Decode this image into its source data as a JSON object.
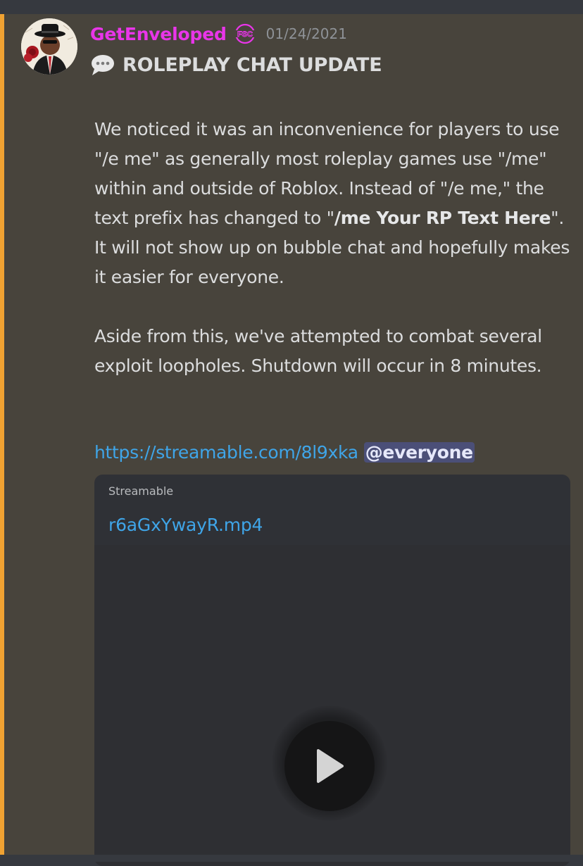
{
  "message": {
    "author": {
      "name": "GetEnveloped",
      "name_color": "#e935e9",
      "avatar_icon": "fedora-gentleman-avatar",
      "badge_icon": "fsc-badge-icon",
      "badge_text": "FSC"
    },
    "timestamp": "01/24/2021",
    "accent_color": "#f0a232",
    "title_icon": "speech-balloon-icon",
    "title": "ROLEPLAY CHAT UPDATE",
    "paragraph1": {
      "part1": "We noticed it was an inconvenience for players to use \"/e me\" as generally most roleplay games use \"/me\" within and outside of Roblox. Instead of \"/e me,\" the text prefix has changed to \"",
      "bold": "/me Your RP Text Here",
      "part2": "\". It will not show up on bubble chat and hopefully makes it easier for everyone."
    },
    "paragraph2": "Aside from this, we've attempted to combat several exploit loopholes. Shutdown will occur in 8 minutes.",
    "link": "https://streamable.com/8l9xka",
    "mention": "@everyone",
    "embed": {
      "provider": "Streamable",
      "title": "r6aGxYwayR.mp4",
      "play_icon": "play-icon"
    }
  }
}
